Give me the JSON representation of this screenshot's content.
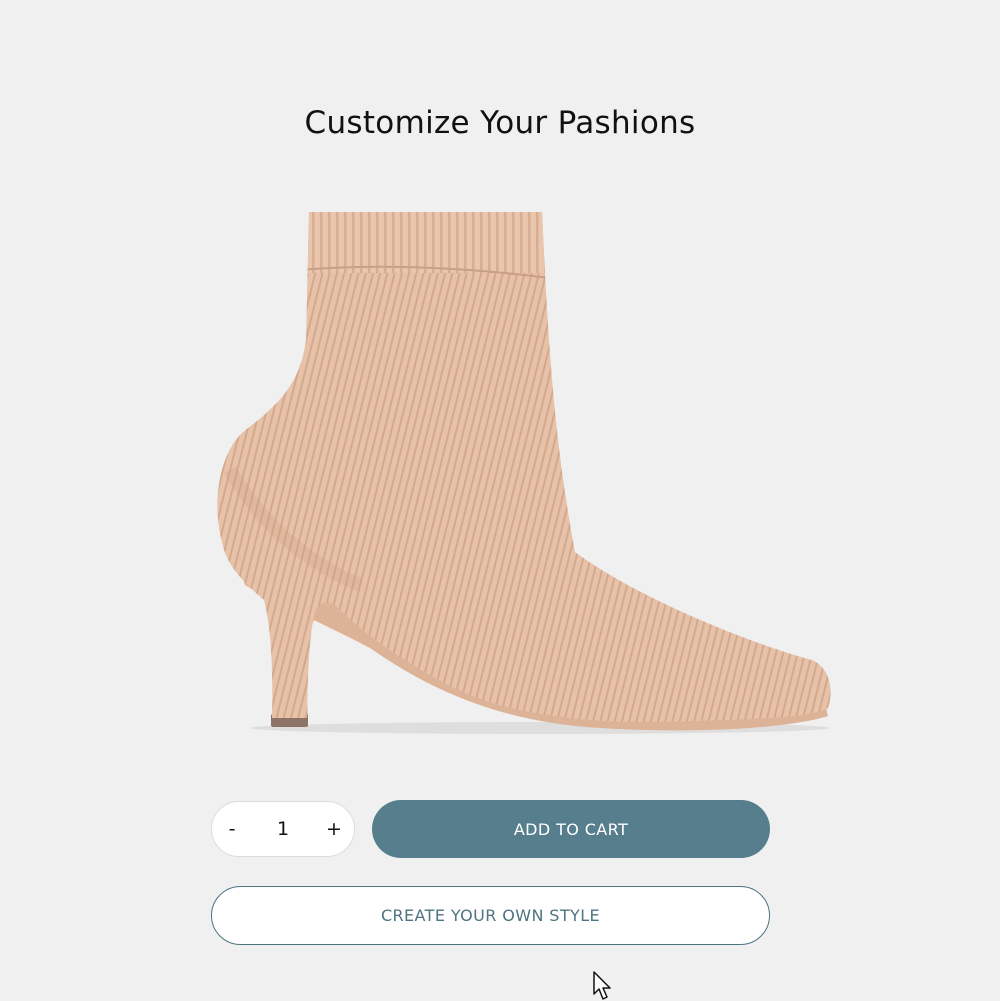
{
  "page": {
    "title": "Customize Your Pashions"
  },
  "product": {
    "image_icon": "ankle-boot-image",
    "color": "#e8c2a8"
  },
  "quantity": {
    "decrement_label": "-",
    "value": "1",
    "increment_label": "+"
  },
  "actions": {
    "add_to_cart_label": "ADD TO CART",
    "create_style_label": "CREATE YOUR OWN STYLE"
  },
  "colors": {
    "background": "#f0f0f0",
    "primary_button": "#567e8c",
    "outline_button": "#4e7381"
  }
}
